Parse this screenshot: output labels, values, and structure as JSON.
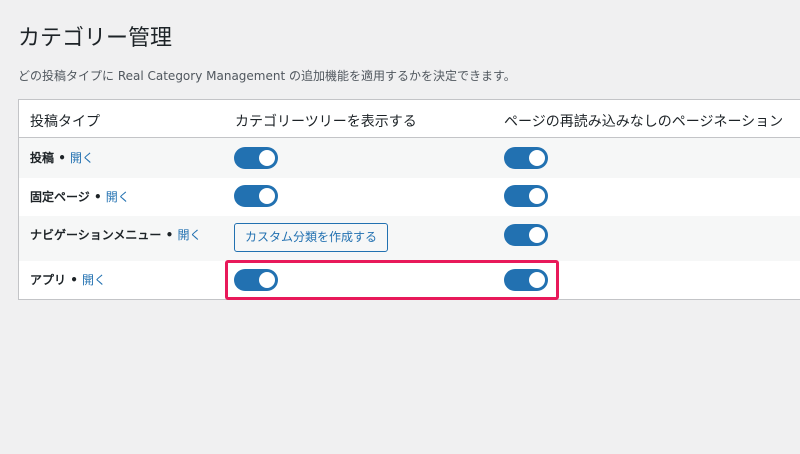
{
  "page": {
    "title": "カテゴリー管理",
    "description": "どの投稿タイプに Real Category Management の追加機能を適用するかを決定できます。"
  },
  "table": {
    "headers": {
      "post_type": "投稿タイプ",
      "show_tree": "カテゴリーツリーを表示する",
      "pagination": "ページの再読み込みなしのページネーション"
    },
    "rows": [
      {
        "label": "投稿",
        "separator": " • ",
        "link": "開く",
        "show_tree": "on",
        "pagination": "on"
      },
      {
        "label": "固定ページ",
        "separator": " • ",
        "link": "開く",
        "show_tree": "on",
        "pagination": "on"
      },
      {
        "label": "ナビゲーションメニュー",
        "separator": " • ",
        "link": "開く",
        "button": "カスタム分類を作成する",
        "pagination": "on"
      },
      {
        "label": "アプリ",
        "separator": " • ",
        "link": "開く",
        "show_tree": "on",
        "pagination": "on"
      }
    ]
  },
  "colors": {
    "accent": "#2271b1",
    "highlight": "#e8195a",
    "background": "#f0f0f1"
  }
}
